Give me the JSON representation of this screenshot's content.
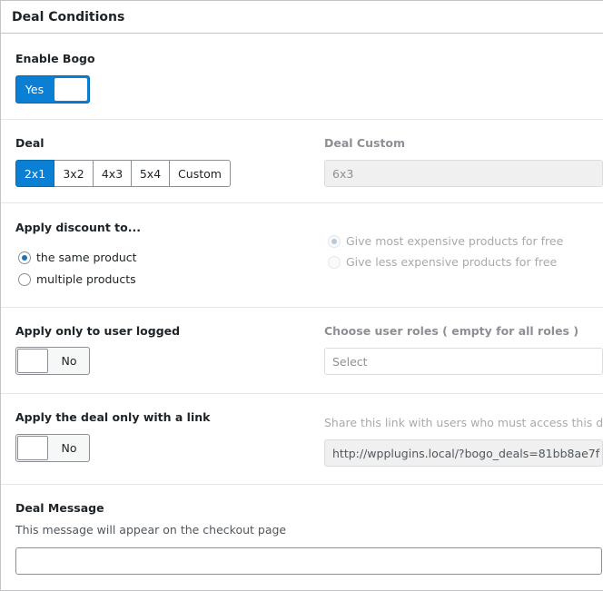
{
  "panel": {
    "title": "Deal Conditions"
  },
  "enable_bogo": {
    "label": "Enable Bogo",
    "toggle_label": "Yes",
    "state": "on"
  },
  "deal": {
    "label": "Deal",
    "options": [
      "2x1",
      "3x2",
      "4x3",
      "5x4",
      "Custom"
    ],
    "selected": "2x1",
    "custom_label": "Deal Custom",
    "custom_value": "6x3"
  },
  "apply_discount": {
    "label": "Apply discount to...",
    "options": [
      "the same product",
      "multiple products"
    ],
    "selected": "the same product",
    "sub_options": [
      "Give most expensive products for free",
      "Give less expensive products for free"
    ],
    "sub_selected": "Give most expensive products for free"
  },
  "user_logged": {
    "label": "Apply only to user logged",
    "toggle_label": "No",
    "state": "off",
    "roles_label": "Choose user roles ( empty for all roles )",
    "roles_placeholder": "Select"
  },
  "deal_link": {
    "label": "Apply the deal only with a link",
    "toggle_label": "No",
    "state": "off",
    "share_label": "Share this link with users who must access this deal",
    "share_url": "http://wpplugins.local/?bogo_deals=81bb8ae7f"
  },
  "deal_message": {
    "label": "Deal Message",
    "description": "This message will appear on the checkout page",
    "value": ""
  },
  "colors": {
    "accent": "#0a7fd4",
    "border": "#c3c4c7"
  }
}
